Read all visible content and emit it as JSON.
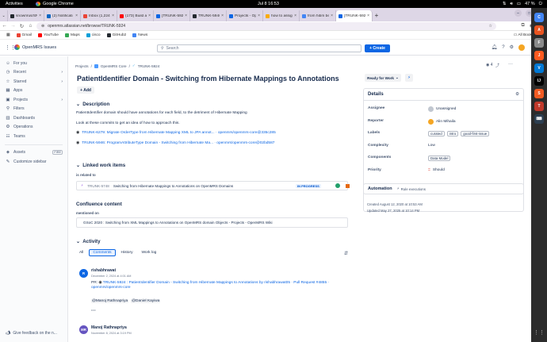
{
  "system_bar": {
    "activities": "Activities",
    "app_name": "Google Chrome",
    "clock": "Jul 8  16:53",
    "battery": "47 %"
  },
  "browser": {
    "tabs": [
      {
        "title": "snowrirus/SN",
        "color": "#24292f",
        "active": false
      },
      {
        "title": "(2) Notificati",
        "color": "#0a66c2",
        "active": false
      },
      {
        "title": "Inbox (1,224",
        "color": "#ea4335",
        "active": false
      },
      {
        "title": "(173) Build a",
        "color": "#ff0000",
        "active": false
      },
      {
        "title": "[TRUNK-5924",
        "color": "#0c66e4",
        "active": false
      },
      {
        "title": "TRUNK-5946",
        "color": "#24292f",
        "active": false
      },
      {
        "title": "Projects - Op",
        "color": "#0c66e4",
        "active": false
      },
      {
        "title": "how to assign",
        "color": "#f9ab00",
        "active": false
      },
      {
        "title": "from hibm be",
        "color": "#4285f4",
        "active": false
      },
      {
        "title": "[TRUNK-592",
        "color": "#0c66e4",
        "active": true
      }
    ],
    "url": "openmrs.atlassian.net/browse/TRUNK-5924",
    "bookmarks": [
      {
        "label": "Gmail",
        "color": "#ea4335"
      },
      {
        "label": "YouTube",
        "color": "#ff0000"
      },
      {
        "label": "Maps",
        "color": "#34a853"
      },
      {
        "label": "cisco",
        "color": "#049fd9"
      },
      {
        "label": "GitHub2",
        "color": "#24292f"
      },
      {
        "label": "News",
        "color": "#4285f4"
      }
    ],
    "all_bookmarks": "All Bookmarks"
  },
  "jira_header": {
    "product": "OpenMRS Issues",
    "search_placeholder": "Search",
    "create_label": "+ Create"
  },
  "sidebar": {
    "items": [
      {
        "label": "For you",
        "icon": "☺",
        "chevron": ""
      },
      {
        "label": "Recent",
        "icon": "◷",
        "chevron": "›"
      },
      {
        "label": "Starred",
        "icon": "☆",
        "chevron": "›"
      },
      {
        "label": "Apps",
        "icon": "▦",
        "chevron": ""
      },
      {
        "label": "Projects",
        "icon": "▣",
        "chevron": "›"
      },
      {
        "label": "Filters",
        "icon": "⚲",
        "chevron": ""
      },
      {
        "label": "Dashboards",
        "icon": "▥",
        "chevron": ""
      },
      {
        "label": "Operations",
        "icon": "⚙",
        "chevron": ""
      },
      {
        "label": "Teams",
        "icon": "☷",
        "chevron": ""
      }
    ],
    "assets_label": "Assets",
    "assets_badge": "FIRE",
    "customize_label": "Customize sidebar",
    "feedback_label": "Give feedback on the n..."
  },
  "issue": {
    "breadcrumb": {
      "projects": "Projects",
      "project": "OpenMRS Core",
      "key": "TRUNK-5924"
    },
    "title": "PatientIdentifier Domain - Switching from Hibernate Mappings to Annotations",
    "add_label": "+ Add",
    "description": {
      "heading": "Description",
      "line1": "PatientIdentifier domain should have annotations for each field, to the detriment of Hibernate Mapping",
      "line2": "Look at these commits to get an idea of how to approach this.",
      "link1": "TRUNK-6279: Migrate OrderType from Hibernate Mapping XML to JPA annot... · openmrs/openmrs-core@335c285",
      "link2": "TRUNK-5946: ProgramAttributeType Domain - Switching from Hibernate Ma... · openmrs/openmrs-core@02bd587"
    },
    "linked": {
      "heading": "Linked work items",
      "relation": "is related to",
      "key": "TRUNK-5748",
      "summary": "Switching from Hibernate Mappings to Annotations on OpenMRS Domains",
      "status": "IN PROGRESS"
    },
    "confluence": {
      "heading": "Confluence content",
      "relation": "mentioned on",
      "page": "GSoC 2020 : Switching from XML Mappings to Annotations on OpenMRS domain Objects - Projects - OpenMRS Wiki"
    },
    "activity": {
      "heading": "Activity",
      "tabs": [
        {
          "label": "All",
          "active": false
        },
        {
          "label": "Comments",
          "active": true
        },
        {
          "label": "History",
          "active": false
        },
        {
          "label": "Work log",
          "active": false
        }
      ],
      "comments": [
        {
          "initials": "R",
          "avatar_color": "#0c66e4",
          "author": "rishabhrawat",
          "date": "December 2, 2024 at 4:01 AM",
          "pr_prefix": "PR: ",
          "pr_link": "TRUNK-5924 : PatientIdentifier Domain - Switching from Hibernate Mappings to Annotations by rishabhrawat05 · Pull Request #4855 · openmrs/openmrs-core",
          "mention1": "@Manoj Rathnapriya",
          "mention2": "@Daniel Kayiwa",
          "more": "···"
        },
        {
          "initials": "MR",
          "avatar_color": "#6554c0",
          "author": "Manoj Rathnapriya",
          "date": "November 8, 2024 at 3:19 PM"
        }
      ]
    }
  },
  "right_panel": {
    "watch_count": "4",
    "status_button": "Ready for Work",
    "details_heading": "Details",
    "fields": [
      {
        "label": "Assignee",
        "value": "Unassigned",
        "avatar": "#c1c7d0"
      },
      {
        "label": "Reporter",
        "value": "Alin Mihaila",
        "avatar": "#f5a623"
      },
      {
        "label": "Labels",
        "labels": [
          "curated",
          "intro",
          "good-first-issue"
        ]
      },
      {
        "label": "Complexity",
        "value": "Low"
      },
      {
        "label": "Components",
        "labels": [
          "Data Model"
        ]
      },
      {
        "label": "Priority",
        "value": "Should",
        "priority_icon": "#e2483d"
      }
    ],
    "automation": {
      "heading": "Automation",
      "rule": "Rule executions"
    },
    "created": "Created August 12, 2020 at 10:53 AM",
    "updated": "Updated May 27, 2025 at 10:14 PM"
  },
  "dock": {
    "apps": [
      {
        "color": "#4285f4",
        "glyph": "C"
      },
      {
        "color": "#e95420",
        "glyph": "A"
      },
      {
        "color": "#8a8a8a",
        "glyph": "F"
      },
      {
        "color": "#ff5a1f",
        "glyph": "J"
      },
      {
        "color": "#0078d4",
        "glyph": "V"
      },
      {
        "color": "#000000",
        "glyph": "IJ"
      },
      {
        "color": "#f15a22",
        "glyph": "S"
      },
      {
        "color": "#c0392b",
        "glyph": "T"
      },
      {
        "color": "#2c3e50",
        "glyph": "⌨"
      }
    ],
    "grid": "⋮⋮"
  }
}
